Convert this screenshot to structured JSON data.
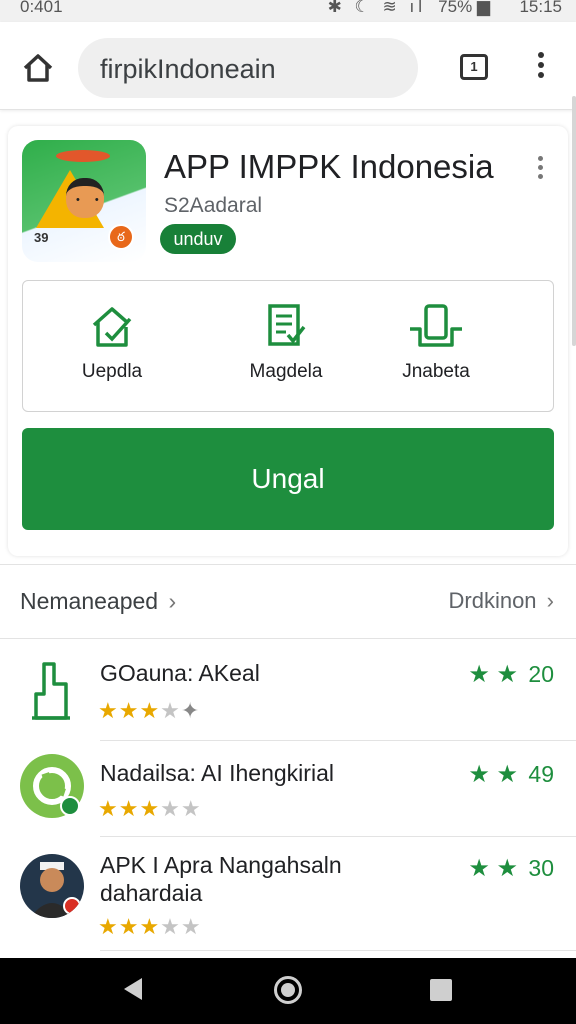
{
  "status_bar": {
    "time": "0:401",
    "icons": "✱ ☾ ≋ ıl",
    "battery": "75% ▆",
    "clock": "15:15"
  },
  "browser": {
    "url": "firpikIndoneain",
    "tab_count": "1"
  },
  "app": {
    "title": "APP IMPPK Indonesia",
    "developer": "S2Aadaral",
    "badge": "unduv",
    "icon_number": "39",
    "actions": [
      {
        "label": "Uepdla",
        "icon": "home-check-icon"
      },
      {
        "label": "Magdela",
        "icon": "document-check-icon"
      },
      {
        "label": "Jnabeta",
        "icon": "phone-tray-icon"
      }
    ],
    "install_label": "Ungal"
  },
  "section": {
    "left_label": "Nemaneaped",
    "right_label": "Drdkinon",
    "chevron": "›"
  },
  "list": [
    {
      "title": "GOauna: AKeal",
      "subtitle": "",
      "stars": "★★★★✦",
      "rating": "20",
      "icon": "thumb-icon"
    },
    {
      "title": "Nadailsa: AI Ihengkirial",
      "subtitle": "",
      "stars": "★★★★★",
      "rating": "49",
      "icon": "phone-circle-icon"
    },
    {
      "title": "APK I Apra Nangahsaln",
      "subtitle": "dahardaia",
      "stars": "★★★★★",
      "rating": "30",
      "icon": "avatar-icon"
    }
  ],
  "rating_stars": "★ ★",
  "colors": {
    "accent": "#1e8e3e",
    "star": "#e8a800"
  }
}
